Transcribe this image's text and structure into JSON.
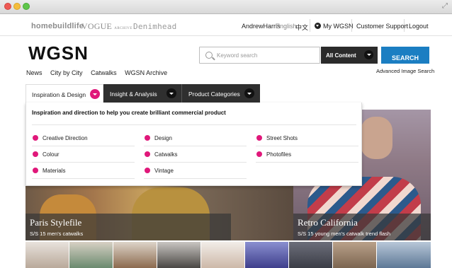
{
  "window": {
    "title": ""
  },
  "topbar": {
    "brands": {
      "homebuildlife": "homebuildlife",
      "vogue": "VOGUE",
      "vogue_sub": "ARCHIVE",
      "denimhead": "Denimhead"
    },
    "user": "AndrewHarris",
    "language": "English",
    "language_alt": "中文",
    "my_wgsn": "My WGSN",
    "support": "Customer Support",
    "logout": "Logout"
  },
  "header": {
    "logo": "WGSN",
    "search_placeholder": "Keyword search",
    "content_select": "All Content",
    "search_button": "SEARCH",
    "advanced_search": "Advanced Image Search"
  },
  "subnav": [
    "News",
    "City by City",
    "Catwalks",
    "WGSN Archive"
  ],
  "mainnav": [
    {
      "label": "Inspiration & Design",
      "active": true
    },
    {
      "label": "Insight & Analysis",
      "active": false
    },
    {
      "label": "Product Categories",
      "active": false
    }
  ],
  "dropdown": {
    "heading": "Inspiration and direction to help you create brilliant commercial product",
    "columns": [
      [
        "Creative Direction",
        "Colour",
        "Materials"
      ],
      [
        "Design",
        "Catwalks",
        "Vintage"
      ],
      [
        "Street Shots",
        "Photofiles"
      ]
    ]
  },
  "hero": {
    "left": {
      "title": "Paris Stylefile",
      "subtitle": "S/S 15 men's catwalks"
    },
    "right": {
      "title": "Retro California",
      "subtitle": "S/S 15 young men's catwalk trend flash"
    }
  },
  "colors": {
    "accent": "#e0187a",
    "search_blue": "#1b7ec2",
    "nav_dark": "#2f2f2f"
  }
}
